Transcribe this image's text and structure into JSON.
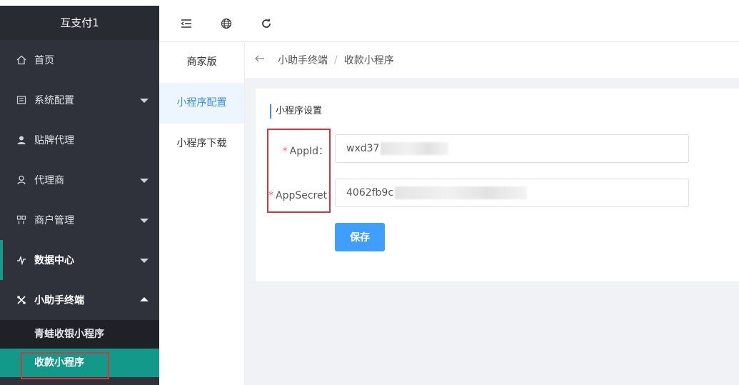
{
  "sidebar": {
    "brand": "互支付1",
    "items": [
      {
        "label": "首页",
        "icon": "home-icon"
      },
      {
        "label": "系统配置",
        "icon": "settings-icon"
      },
      {
        "label": "贴牌代理",
        "icon": "user-icon"
      },
      {
        "label": "代理商",
        "icon": "person-icon"
      },
      {
        "label": "商户管理",
        "icon": "grid-icon"
      },
      {
        "label": "数据中心",
        "icon": "pulse-icon"
      },
      {
        "label": "小助手终端",
        "icon": "tools-icon"
      }
    ],
    "sub_items": [
      {
        "label": "青蛙收银小程序"
      },
      {
        "label": "收款小程序"
      }
    ],
    "accent_color": "#159b86",
    "active_color": "#12998a"
  },
  "toolbar": {
    "icons": [
      "menu-fold-icon",
      "globe-icon",
      "refresh-icon"
    ]
  },
  "subnav": {
    "items": [
      {
        "label": "商家版"
      },
      {
        "label": "小程序配置"
      },
      {
        "label": "小程序下载"
      }
    ]
  },
  "breadcrumb": {
    "items": [
      "小助手终端",
      "收款小程序"
    ],
    "separator": "/"
  },
  "form": {
    "title": "小程序设置",
    "appid_label": "AppId：",
    "appid_value": "wxd37",
    "appsecret_label": "AppSecret：",
    "appsecret_value": "4062fb9c",
    "required_mark": "*",
    "save_label": "保存",
    "primary_color": "#409eff"
  }
}
